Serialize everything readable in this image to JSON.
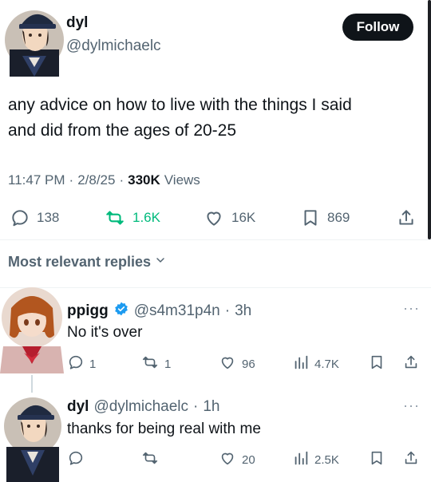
{
  "tweet": {
    "author_name": "dyl",
    "author_handle": "@dylmichaelc",
    "follow_label": "Follow",
    "text_line1": "any advice on how to live with the things I said",
    "text_line2": "and did from the ages of 20-25",
    "time": "11:47 PM",
    "date": "2/8/25",
    "views_count": "330K",
    "views_label": "Views",
    "replies": "138",
    "reposts": "1.6K",
    "likes": "16K",
    "bookmarks": "869",
    "accent_repost": "#00ba7c"
  },
  "replies_header": {
    "label": "Most relevant replies"
  },
  "replies": [
    {
      "name": "ppigg",
      "handle": "@s4m31p4n",
      "time": "3h",
      "text": "No it's over",
      "replies": "1",
      "reposts": "1",
      "likes": "96",
      "views": "4.7K",
      "verified_color": "#1d9bf0"
    },
    {
      "name": "dyl",
      "handle": "@dylmichaelc",
      "time": "1h",
      "text": "thanks for being real with me",
      "likes": "20",
      "views": "2.5K"
    }
  ],
  "separator": "·"
}
